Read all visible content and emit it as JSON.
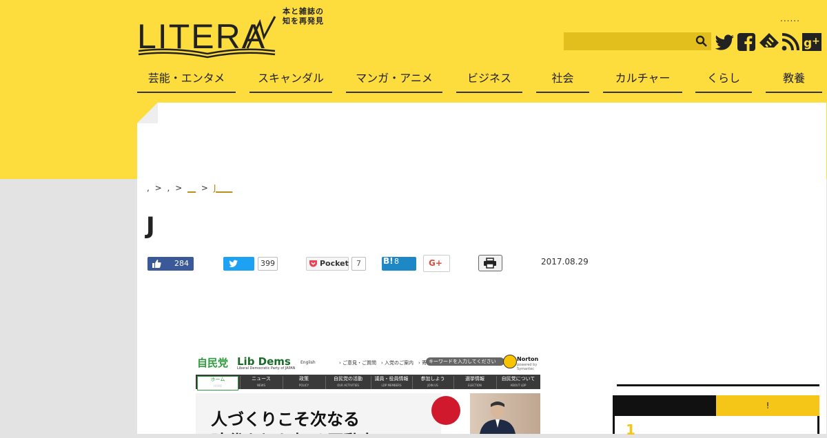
{
  "header": {
    "logo_text": "LITERA",
    "tagline_line1": "本と雑誌の",
    "tagline_line2": "知を再発見",
    "top_dots": "......",
    "search_placeholder": "",
    "social_icons": [
      "twitter-icon",
      "facebook-icon",
      "feedly-icon",
      "rss-icon",
      "google-plus-icon"
    ]
  },
  "nav": {
    "items": [
      {
        "label": "芸能・エンタメ"
      },
      {
        "label": "スキャンダル"
      },
      {
        "label": "マンガ・アニメ"
      },
      {
        "label": "ビジネス"
      },
      {
        "label": "社会"
      },
      {
        "label": "カルチャー"
      },
      {
        "label": "くらし"
      },
      {
        "label": "教養"
      }
    ]
  },
  "breadcrumb": {
    "item1": ",",
    "item2": ",",
    "item3": "__",
    "item4": "J____",
    "sep": ">"
  },
  "article": {
    "title": "J",
    "date": "2017.08.29"
  },
  "share": {
    "like_count": "284",
    "tweet_count": "399",
    "pocket_label": "Pocket",
    "pocket_count": "7",
    "hatena_label": "B!",
    "hatena_count": "8",
    "gplus_label": "G+"
  },
  "embedded_screenshot": {
    "party_jp": "自民党",
    "party_en": "Lib Dems",
    "party_sub": "Liberal Democratic Party of JAPAN",
    "english_link": "English",
    "top_links": "› ご意見・ご質問　› 入党のご案内　› 寄付",
    "search_placeholder": "キーワードを入力してください",
    "norton_label": "Norton",
    "norton_sub": "powered by Symantec",
    "nav": [
      {
        "label": "ホーム",
        "en": "HOME"
      },
      {
        "label": "ニュース",
        "en": "NEWS"
      },
      {
        "label": "政策",
        "en": "POLICY"
      },
      {
        "label": "自民党の活動",
        "en": "OUR ACTIVITIES"
      },
      {
        "label": "議員・役員情報",
        "en": "LDP MEMBERS"
      },
      {
        "label": "参加しよう",
        "en": "JOIN US"
      },
      {
        "label": "選挙情報",
        "en": "ELECTION"
      },
      {
        "label": "自民党について",
        "en": "ABOUT LDP"
      }
    ],
    "banner_line1": "人づくりこそ次なる",
    "banner_line2": "時代を切り拓く原動力"
  },
  "sidebar": {
    "tab_b_label": "!",
    "rank_first": "1"
  },
  "colors": {
    "brand_yellow": "#fddc3e",
    "search_bg": "#e3bf1e",
    "facebook": "#3b5998",
    "twitter": "#1da1f2",
    "hatena": "#1e88c7"
  }
}
